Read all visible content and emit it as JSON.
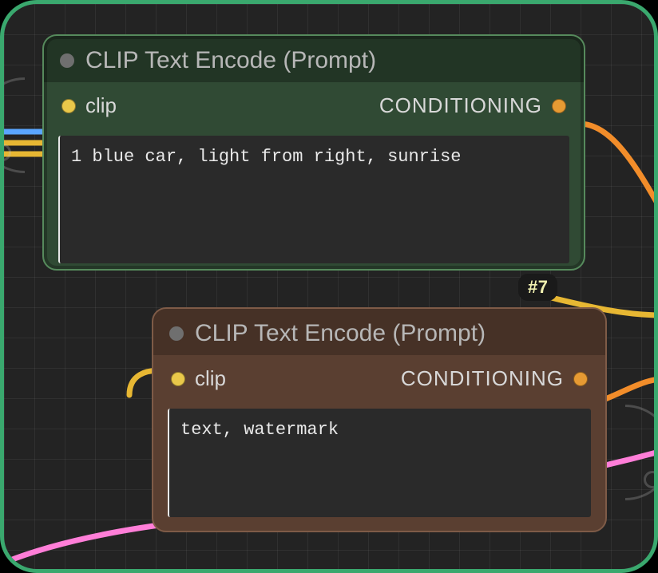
{
  "badge": {
    "label": "#7"
  },
  "nodes": {
    "positive": {
      "title": "CLIP Text Encode (Prompt)",
      "input": {
        "label": "clip"
      },
      "output": {
        "label": "CONDITIONING"
      },
      "prompt": "1 blue car, light from right, sunrise"
    },
    "negative": {
      "title": "CLIP Text Encode (Prompt)",
      "input": {
        "label": "clip"
      },
      "output": {
        "label": "CONDITIONING"
      },
      "prompt": "text, watermark"
    }
  },
  "colors": {
    "node_positive": "#304a34",
    "node_negative": "#5a3f31",
    "port_input": "#e9c84a",
    "port_output": "#e69a33",
    "wire_blue": "#5aa6ff",
    "wire_yellow": "#e7b733",
    "wire_pink": "#ff7ed8",
    "wire_orange": "#f28d2a"
  }
}
